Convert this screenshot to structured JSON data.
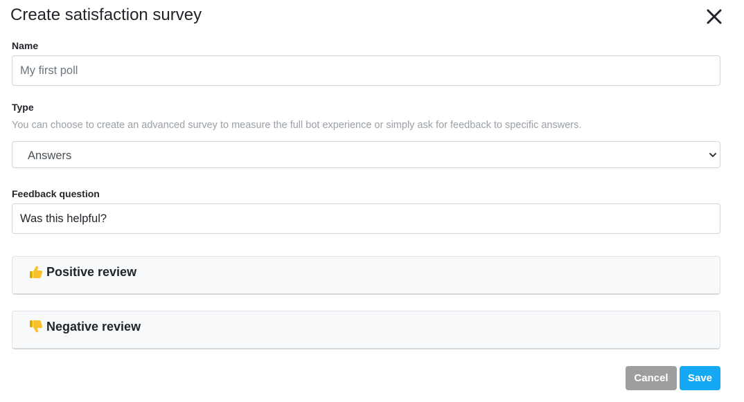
{
  "dialog": {
    "title": "Create satisfaction survey",
    "close_icon": "close-icon"
  },
  "form": {
    "name": {
      "label": "Name",
      "value": "",
      "placeholder": "My first poll"
    },
    "type": {
      "label": "Type",
      "help": "You can choose to create an advanced survey to measure the full bot experience or simply ask for feedback to specific answers.",
      "selected": "Answers"
    },
    "feedback_question": {
      "label": "Feedback question",
      "value": "Was this helpful?"
    },
    "sections": {
      "positive": {
        "label": "Positive review",
        "icon": "thumbs-up-icon"
      },
      "negative": {
        "label": "Negative review",
        "icon": "thumbs-down-icon"
      }
    }
  },
  "actions": {
    "cancel_label": "Cancel",
    "save_label": "Save"
  },
  "colors": {
    "save": "#14a8f5",
    "cancel": "#9e9e9e",
    "emoji": "#f7c02c"
  }
}
